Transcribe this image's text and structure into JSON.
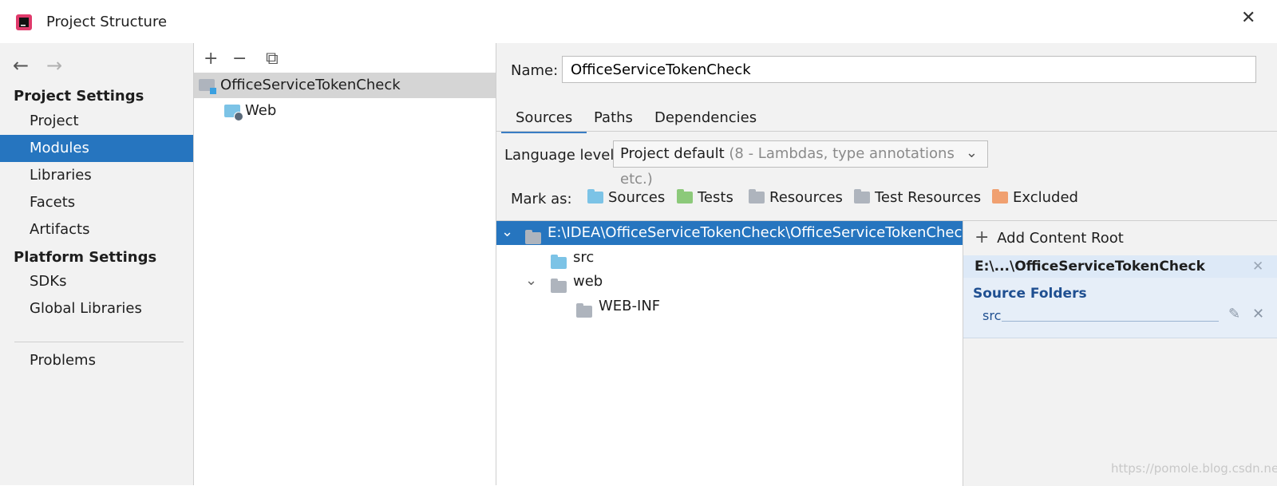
{
  "window": {
    "title": "Project Structure",
    "close_glyph": "✕"
  },
  "sidebar": {
    "back_glyph": "←",
    "forward_glyph": "→",
    "project_settings": "Project Settings",
    "platform_settings": "Platform Settings",
    "items": [
      {
        "label": "Project"
      },
      {
        "label": "Modules"
      },
      {
        "label": "Libraries"
      },
      {
        "label": "Facets"
      },
      {
        "label": "Artifacts"
      },
      {
        "label": "SDKs"
      },
      {
        "label": "Global Libraries"
      },
      {
        "label": "Problems"
      }
    ]
  },
  "modules": {
    "add_glyph": "+",
    "remove_glyph": "−",
    "copy_glyph": "⧉",
    "list": [
      {
        "label": "OfficeServiceTokenCheck"
      },
      {
        "label": "Web"
      }
    ]
  },
  "detail": {
    "name_label": "Name:",
    "name_value": "OfficeServiceTokenCheck",
    "tabs": [
      "Sources",
      "Paths",
      "Dependencies"
    ],
    "language_label": "Language level:",
    "language_value": "Project default",
    "language_hint": "(8 - Lambdas, type annotations etc.)",
    "dropdown_glyph": "⌄",
    "mark_label": "Mark as:",
    "mark_items": [
      {
        "label": "Sources",
        "color": "#7cc3e6"
      },
      {
        "label": "Tests",
        "color": "#8cc97a"
      },
      {
        "label": "Resources",
        "color": "#aeb4bd"
      },
      {
        "label": "Test Resources",
        "color": "#aeb4bd"
      },
      {
        "label": "Excluded",
        "color": "#f0a070"
      }
    ]
  },
  "tree": {
    "rows": [
      {
        "label": "E:\\IDEA\\OfficeServiceTokenCheck\\OfficeServiceTokenCheck"
      },
      {
        "label": "src"
      },
      {
        "label": "web"
      },
      {
        "label": "WEB-INF"
      }
    ],
    "expanded_glyph": "⌄"
  },
  "roots": {
    "add_label": "Add Content Root",
    "add_glyph": "+",
    "root_path": "E:\\...\\OfficeServiceTokenCheck",
    "source_folders_label": "Source Folders",
    "source_item": "src",
    "remove_glyph": "✕",
    "edit_glyph": "✎"
  },
  "watermark": "https://pomole.blog.csdn.net"
}
